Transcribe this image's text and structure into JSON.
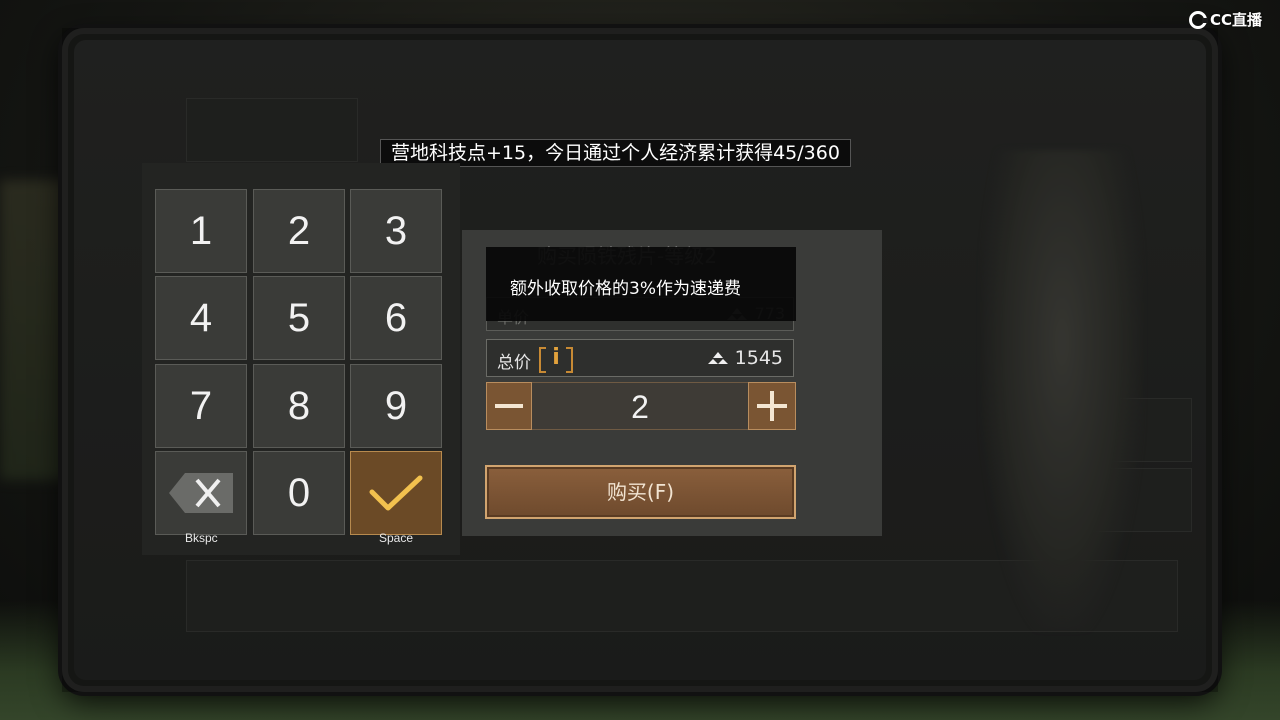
{
  "watermark": {
    "logo_text": "CC直播"
  },
  "banner": {
    "text": "营地科技点+15，今日通过个人经济累计获得45/360"
  },
  "keypad": {
    "keys": [
      "1",
      "2",
      "3",
      "4",
      "5",
      "6",
      "7",
      "8",
      "9",
      "",
      "0",
      ""
    ],
    "backspace_hint": "Bkspc",
    "confirm_hint": "Space"
  },
  "purchase": {
    "title": "购买陨铁残片-等级2",
    "tooltip": "额外收取价格的3%作为速递费",
    "unit_price_label": "单价",
    "unit_price_value": "773",
    "total_label": "总价",
    "info_icon_text": "i",
    "total_value": "1545",
    "quantity": "2",
    "buy_label": "购买(F)"
  },
  "colors": {
    "accent_gold": "#e2a23c",
    "button_bronze": "#7a5533",
    "confirm_key": "#6b4a26"
  },
  "icons": [
    "backspace-icon",
    "checkmark-icon",
    "minus-icon",
    "plus-icon",
    "info-icon",
    "currency-icon",
    "cc-logo-icon"
  ]
}
